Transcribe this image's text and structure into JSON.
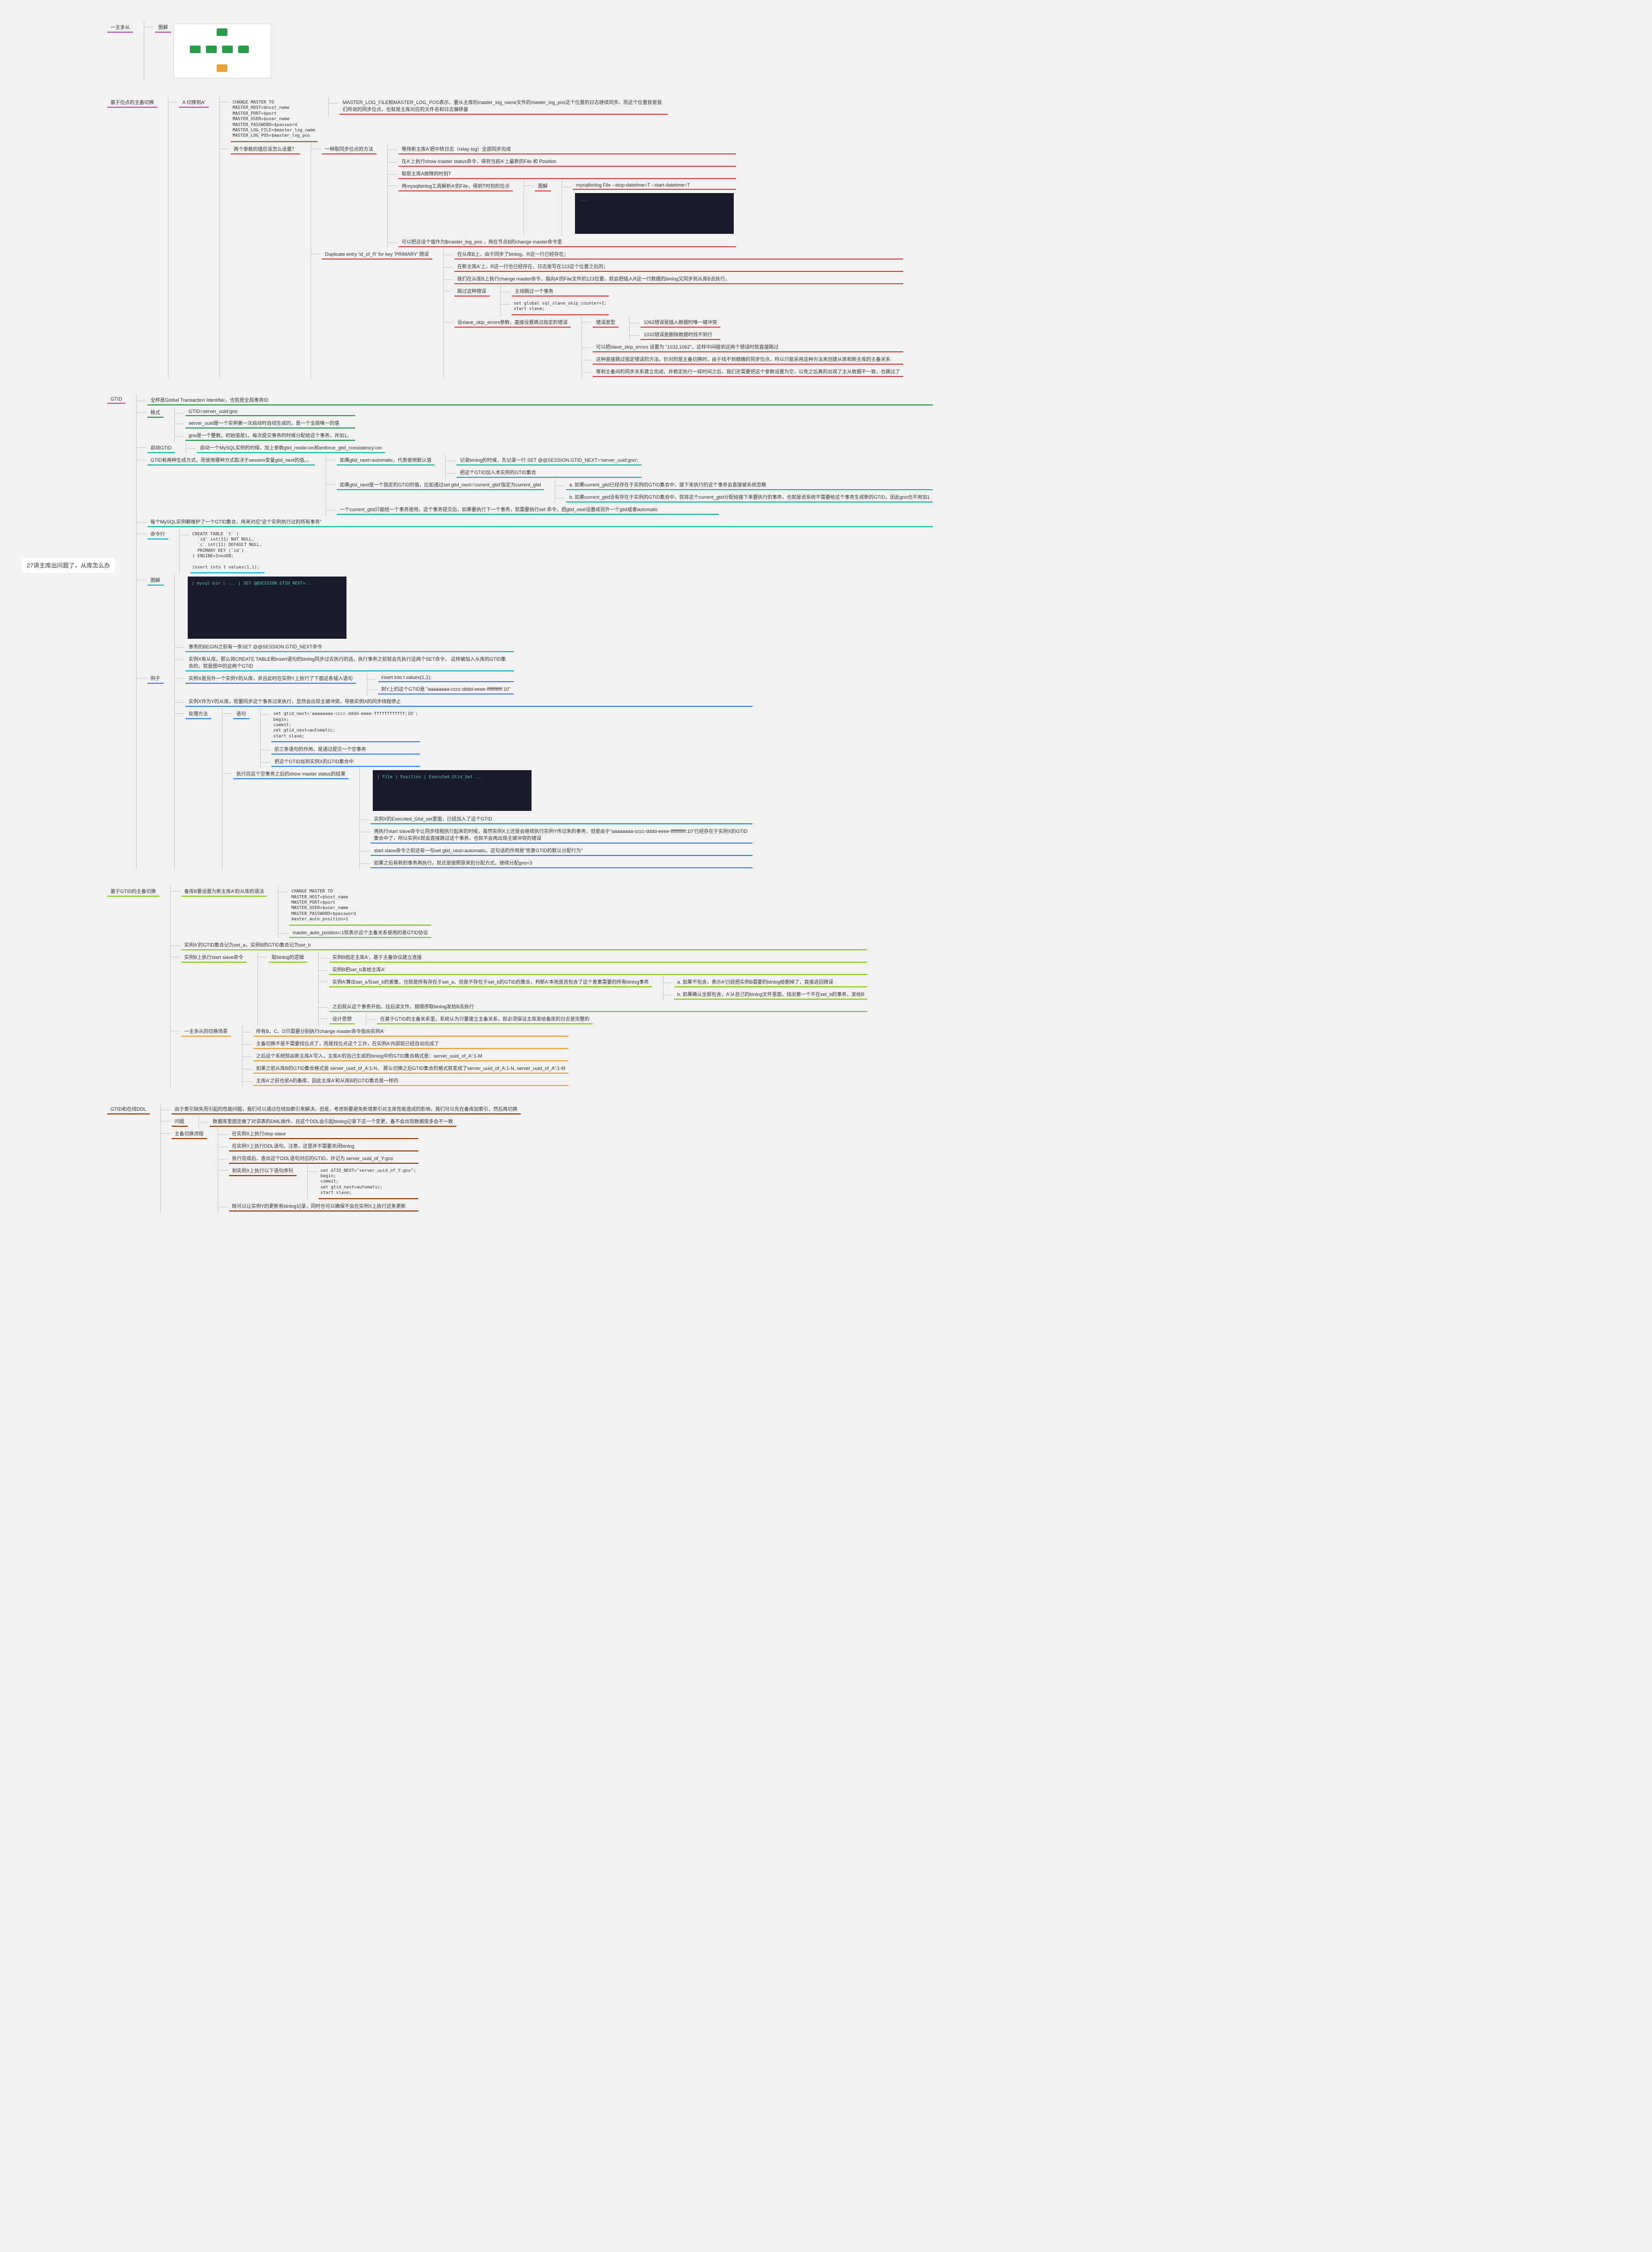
{
  "root": "27讲主库出问题了，从库怎么办",
  "b1": {
    "label": "一主多从",
    "img_label": "图解"
  },
  "b2": {
    "label": "基于位点的主备切换",
    "sub": "A 切换到A'",
    "config": "CHANGE MASTER TO\nMASTER_HOST=$host_name\nMASTER_PORT=$port\nMASTER_USER=$user_name\nMASTER_PASSWORD=$password\nMASTER_LOG_FILE=$master_log_name\nMASTER_LOG_POS=$master_log_pos",
    "note1": "MASTER_LOG_FILE和MASTER_LOG_POS表示，要从主库的master_log_name文件的master_log_pos这个位置的日志继续同步。而这个位置就是我们所说的同步位点，也就是主库对应的文件名和日志偏移量",
    "q": "两个参数的值应该怎么设置？",
    "m1": "等待新主库A'把中转日志（relay log）全部同步完成",
    "m2": "在A'上执行show master status命令，得到当前A'上最新的File 和 Position",
    "m3": "取原主库A故障的时刻T",
    "m4": "用mysqlbinlog工具解析A'的File，得到T时刻的位点",
    "m4_img": "图解",
    "m4_cmd": "mysqlbinlog File --stop-datetime=T --start-datetime=T",
    "m5": "可以把这设个值作为$master_log_pos ，用在节点B的change master命令里",
    "method_label": "一种取同步位点的方法",
    "dup_label": "Duplicate entry 'id_of_R' for key 'PRIMARY' 错误",
    "dup_r1": "在从库B上，由于同步了binlog，R这一行已经存在；",
    "dup_r2": "在新主库A'上，R这一行也已经存在，日志是写在123这个位置之后的；",
    "dup_r3": "我们在从库B上执行change master命令，指向A'的File文件的123位置，就会把插入R这一行数据的binlog又同步到从库B去执行。",
    "skip_label": "跳过这种错误",
    "skip_r1": "主动跳过一个事务",
    "skip_r2": "set global sql_slave_skip_counter=1;\nstart slave;",
    "slave_skip_label": "设slave_skip_errors参数，直接设置跳过指定的错误",
    "err_types_label": "错误类型",
    "err1": "1062错误是插入数据时唯一键冲突",
    "err2": "1032错误是删除数据时找不到行",
    "ss1": "可以把slave_skip_errors 设置为 \"1032,1062\"，这样中间碰到这两个错误时就直接跳过",
    "ss2": "这种直接跳过指定错误的方法，针对的是主备切换时，由于找不到精确的同步位点，所以只能采用这种方法来创建从库和新主库的主备关系",
    "ss3": "等到主备间的同步关系建立完成，并稳定执行一段时间之后，我们还需要把这个参数设置为空，以免之后真的出现了主从数据不一致，也跳过了"
  },
  "b3": {
    "label": "GTID",
    "full": "全称是Global Transaction Identifier，也就是全局事务ID",
    "fmt_label": "格式",
    "fmt": "GTID=server_uuid:gno",
    "fmt_r1": "server_uuid是一个实例第一次启动时自动生成的，是一个全局唯一的值",
    "fmt_r2": "gno是一个整数，初始值是1，每次提交事务的时候分配给这个事务，并加1。",
    "start_label": "启动GTID",
    "start": "启动一个MySQL实例的时候，加上参数gtid_mode=on和enforce_gtid_consistency=on",
    "gen_label": "GTID有两种生成方式，而使用哪种方式取决于session变量gtid_next的值。。",
    "auto_label": "如果gtid_next=automatic，代表使用默认值",
    "auto_r1": "记录binlog的时候，先记录一行 SET @@SESSION.GTID_NEXT='server_uuid:gno';",
    "auto_r2": "把这个GTID加入本实例的GTID集合",
    "spec_label": "如果gtid_next是一个指定的GTID的值，比如通过set gtid_next='current_gtid'指定为current_gtid",
    "spec_a": "a. 如果current_gtid已经存在于实例的GTID集合中，接下来执行的这个事务会直接被系统忽略",
    "spec_b": "b. 如果current_gtid没有存在于实例的GTID集合中，就将这个current_gtid分配给接下来要执行的事务，也就是说系统不需要给这个事务生成新的GTID，因此gno也不用加1",
    "one": "一个current_gtid只能给一个事务使用。这个事务提交后，如果要执行下一个事务，就需要执行set 命令，把gtid_next设置成另外一个gtid或者automatic",
    "maintain": "每个MySQL实例都维护了一个GTID集合，用来对应\"这个实例执行过的所有事务\"",
    "cmd_label": "命令行",
    "cmd_sql": "CREATE TABLE `t` (\n  `id` int(11) NOT NULL,\n  `c` int(11) DEFAULT NULL,\n  PRIMARY KEY (`id`)\n) ENGINE=InnoDB;\n\ninsert into t values(1,1);",
    "img_label": "图解",
    "img_r1": "事务的BEGIN之前有一条SET @@SESSION.GTID_NEXT命令",
    "img_r2": "实例X有从库，那么将CREATE TABLE和insert语句的binlog同步过去执行的话，执行事务之前就会先执行这两个SET命令， 这样被加入从库的GTID集合的，就是图中的这两个GTID",
    "ex_label": "例子",
    "ex_r1": "实例X是另外一个实例Y的从库，并且此时在实例Y上执行了下面这条插入语句",
    "ex_r1a": "insert into t values(1,1);",
    "ex_r1b": "到Y上的这个GTID是 \"aaaaaaaa-cccc-dddd-eeee-ffffffffffff:10\"",
    "ex_r2": "实例X作为Y的从库，就要同步这个事务过来执行，显然会出现主键冲突，导致实例X的同步线程停止",
    "fix_label": "处理方法",
    "fix_sql_label": "语句",
    "fix_sql": "set gtid_next='aaaaaaaa-cccc-dddd-eeee-ffffffffffff:10';\nbegin;\ncommit;\nset gtid_next=automatic;\nstart slave;",
    "fix_r1": "前三条语句的作用，是通过提交一个空事务",
    "fix_r2": "把这个GTID加到实例X的GTID集合中",
    "sms_label": "执行完这个空事务之后的show master status的结果",
    "sms_r1": "实例X的Executed_Gtid_set里面，已经加入了这个GTID",
    "sms_r2": "再执行start slave命令让同步线程执行起来的时候，虽然实例X上还是会继续执行实例Y传过来的事务，但是由于\"aaaaaaaa-cccc-dddd-eeee-ffffffffffff:10\"已经存在于实例X的GTID集合中了，所以实例X就会直接跳过这个事务，也就不会再出现主键冲突的错误",
    "sms_r3": "start slave命令之前还有一句set gtid_next=automatic。这句话的作用是\"恢复GTID的默认分配行为\"",
    "sms_r4": "如果之后有新的事务再执行，就还是按照原来的分配方式，继续分配gno=3"
  },
  "b4": {
    "label": "基于GTID的主备切换",
    "prep_label": "备库B要设置为新主库A'的从库的语法",
    "prep_sql": "CHANGE MASTER TO\nMASTER_HOST=$host_name\nMASTER_PORT=$port\nMASTER_USER=$user_name\nMASTER_PASSWORD=$password\nmaster_auto_position=1",
    "prep_note": "master_auto_position=1就表示这个主备关系使用的是GTID协议",
    "set_note": "实例A'的GTID集合记为set_a，实例B的GTID集合记为set_b",
    "start_label": "实例B上执行start slave命令",
    "logic_label": "取binlog的逻辑",
    "l1": "实例B指定主库A'，基于主备协议建立连接",
    "l2": "实例B把set_b发给主库A'",
    "l3": "实例A'算出set_a与set_b的差集，也就是所有存在于set_a，但是不存在于set_b的GTID的集合，判断A'本地是否包含了这个差集需要的所有binlog事务",
    "l3a": "a. 如果不包含，表示A'已经把实例B需要的binlog给删掉了，直接返回错误",
    "l3b": "b. 如果确认全部包含，A'从自己的binlog文件里面，找出第一个不在set_b的事务，发给B",
    "l4": "之后就从这个事务开始，往后读文件，按顺序取binlog发给B去执行",
    "design_label": "设计思想",
    "design": "在基于GTID的主备关系里，系统认为只要建立主备关系，就必须保证主库发给备库的日志是完整的",
    "sw_label": "一主多从的切换场景",
    "sw1": "所有B、C、D只需要分别执行change master命令指向实例A'",
    "sw2": "主备切换不是不需要找位点了，而是找位点这个工作，在实例A'内部就已经自动完成了",
    "sw3": "之后这个系统就由新主库A'写入，主库A'的自己生成的binlog中的GTID集合格式是：server_uuid_of_A':1-M",
    "sw4": "如果之前从库B的GTID集合格式是 server_uuid_of_A:1-N， 那么切换之后GTID集合的格式就变成了server_uuid_of_A:1-N, server_uuid_of_A':1-M",
    "sw5": "主库A'之前也是A的备库，因此主库A'和从库B的GTID集合是一样的"
  },
  "b5": {
    "label": "GTID和在线DDL",
    "intro": "由于索引缺失而引起的性能问题，我们可以通过在线加索引来解决。但是，考虑到要避免新增索引对主库性能造成的影响，我们可以先在备库加索引，然后再切换",
    "problem_label": "问题",
    "problem": "数据库里面还做了对该表的DML操作，且这个DDL会引起binlog记录下这一个变更，备不会出现数据很多会不一致",
    "flow_label": "主备切换流程",
    "f1": "在实例X上执行stop slave",
    "f2": "在实例Y上执行DDL语句。注意，这里并不需要关闭binlog",
    "f3": "执行完成后，查出这个DDL语句对应的GTID，并记为 server_uuid_of_Y:gno",
    "f4": "到实例X上执行以下语句序列",
    "f4_sql": "set GTID_NEXT=\"server_uuid_of_Y:gno\";\nbegin;\ncommit;\nset gtid_next=automatic;\nstart slave;",
    "f5": "既可以让实例Y的更新有binlog记录，同时也可以确保不会在实例X上执行这条更新"
  }
}
